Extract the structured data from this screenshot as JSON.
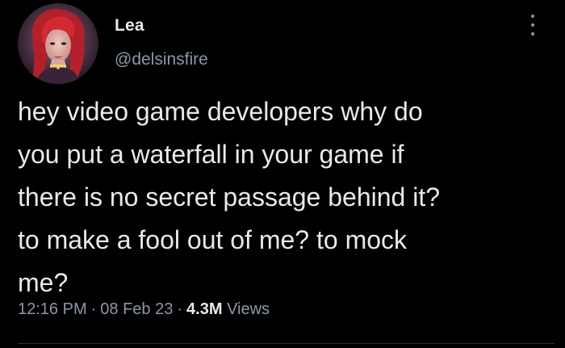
{
  "author": {
    "display_name": "Lea",
    "handle": "@delsinsfire"
  },
  "tweet": {
    "lines": [
      "hey video game developers why do",
      "you put a waterfall in your game if",
      "there is no secret passage behind it?",
      "to make a fool out of me? to mock",
      "me?"
    ],
    "time": "12:16 PM",
    "separator": "·",
    "date": "08 Feb 23",
    "views_count": "4.3M",
    "views_label": "Views"
  },
  "icons": {
    "more": "more-vertical-icon",
    "avatar": "avatar-image"
  },
  "colors": {
    "background": "#000000",
    "primary_text": "#e7e9ea",
    "secondary_text": "#8b98a5"
  }
}
